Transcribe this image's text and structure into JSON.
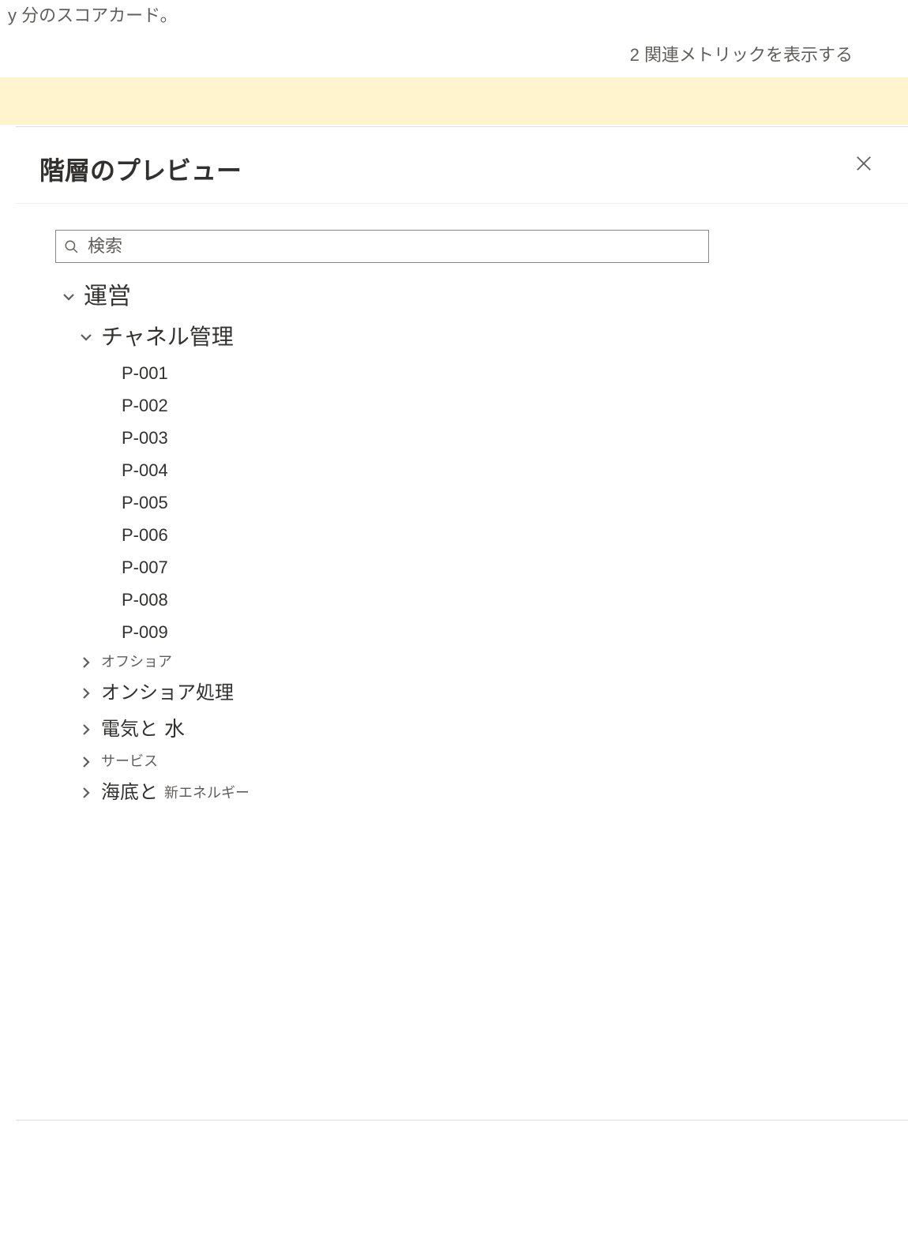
{
  "top": {
    "scorecard_suffix": "y 分のスコアカード。",
    "related_link": "2 関連メトリックを表示する"
  },
  "panel": {
    "title": "階層のプレビュー"
  },
  "search": {
    "placeholder": "検索"
  },
  "tree": {
    "root": "運営",
    "node1": {
      "label": "チャネル管理",
      "items": [
        "P-001",
        "P-002",
        "P-003",
        "P-004",
        "P-005",
        "P-006",
        "P-007",
        "P-008",
        "P-009"
      ]
    },
    "node2": "オフショア",
    "node3": "オンショア処理",
    "node4_a": "電気と",
    "node4_b": "水",
    "node5": "サービス",
    "node6_a": "海底と",
    "node6_b": "新エネルギー"
  }
}
